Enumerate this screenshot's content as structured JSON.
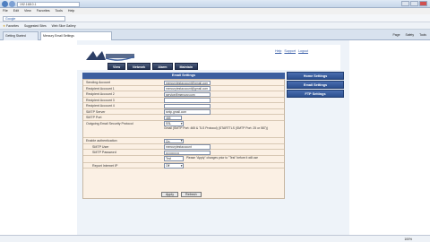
{
  "browser": {
    "url": "192.168.0.1",
    "menu": [
      "File",
      "Edit",
      "View",
      "Favorites",
      "Tools",
      "Help"
    ],
    "google_label": "Google",
    "favorites_label": "Favorites",
    "fav_items": [
      "Suggested Sites",
      "Web Slice Gallery"
    ],
    "tabs": [
      "Getting Started",
      "Mercury Email Settings"
    ],
    "right_tools": [
      "Page",
      "Safety",
      "Tools"
    ],
    "zoom": "100%"
  },
  "app": {
    "help_links": [
      "Help",
      "Support",
      "Logout"
    ],
    "nav": [
      "View",
      "Network",
      "Alarm",
      "Maintain"
    ],
    "panel_title": "Email Settings",
    "rows": [
      {
        "label": "Sending Account",
        "value": "mercurytestaccount@gmail.com"
      },
      {
        "label": "Recipient Account 1",
        "value": "mercurytestaccount@gmail.com"
      },
      {
        "label": "Recipient Account 2",
        "value": "service@mercury.com"
      },
      {
        "label": "Recipient Account 3",
        "value": ""
      },
      {
        "label": "Recipient Account 4",
        "value": ""
      },
      {
        "label": "SMTP Server",
        "value": "smtp.gmail.com"
      },
      {
        "label": "SMTP Port",
        "value": "465"
      }
    ],
    "security_label": "Outgoing Email Security Protocol",
    "security_value": "SSL",
    "security_note": "Gmail (SMTP Port: 465 & TLS Protocol) (STARTTLS (SMTP Port: 25 or 587))",
    "auth_label": "Enable authentication",
    "auth_value": "On",
    "user_label": "SMTP User",
    "user_value": "mercurytestaccount",
    "pass_label": "SMTP Password",
    "pass_value": "•••••••••••••",
    "test_value": "Test",
    "test_note": "Please \"Apply\" changes prior to \"Test\" before it will use",
    "ip_label": "Report Internet IP",
    "ip_value": "Off",
    "apply_label": "Apply",
    "refresh_label": "Refresh"
  },
  "side": [
    "Home Settings",
    "Email Settings",
    "FTP Settings"
  ]
}
